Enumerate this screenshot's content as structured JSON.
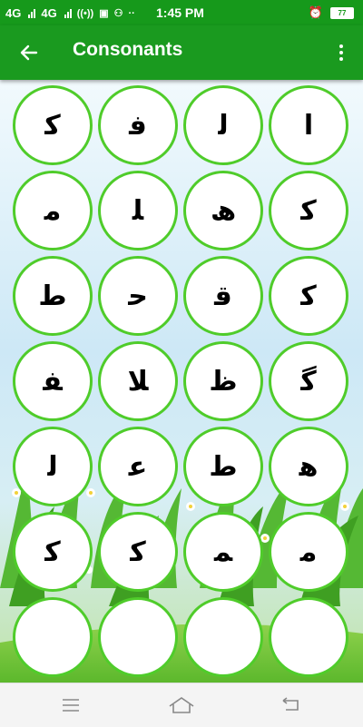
{
  "status_bar": {
    "network1": "4G",
    "network2": "4G",
    "time": "1:45 PM",
    "battery": "77"
  },
  "app_bar": {
    "title": "Consonants"
  },
  "letters": [
    "ﮐ",
    "ﻓ",
    "ﻟ",
    "ﺍ",
    "ﻣ",
    "ﻠ",
    "ﮪ",
    "ﻛ",
    "ﻁ",
    "ﺣ",
    "ﻗ",
    "ﻛ",
    "ﻔ",
    "ﻼ",
    "ﻅ",
    "ﮔ",
    "ﻟ",
    "ﻋ",
    "ﻁ",
    "ﻫ",
    "ﮐ",
    "ﻛ",
    "ﻤ",
    "ﻣ"
  ],
  "partial_row_count": 4,
  "colors": {
    "primary": "#1a9a1f",
    "circle_border": "#4fcc2a",
    "grass": "#5cc236"
  }
}
